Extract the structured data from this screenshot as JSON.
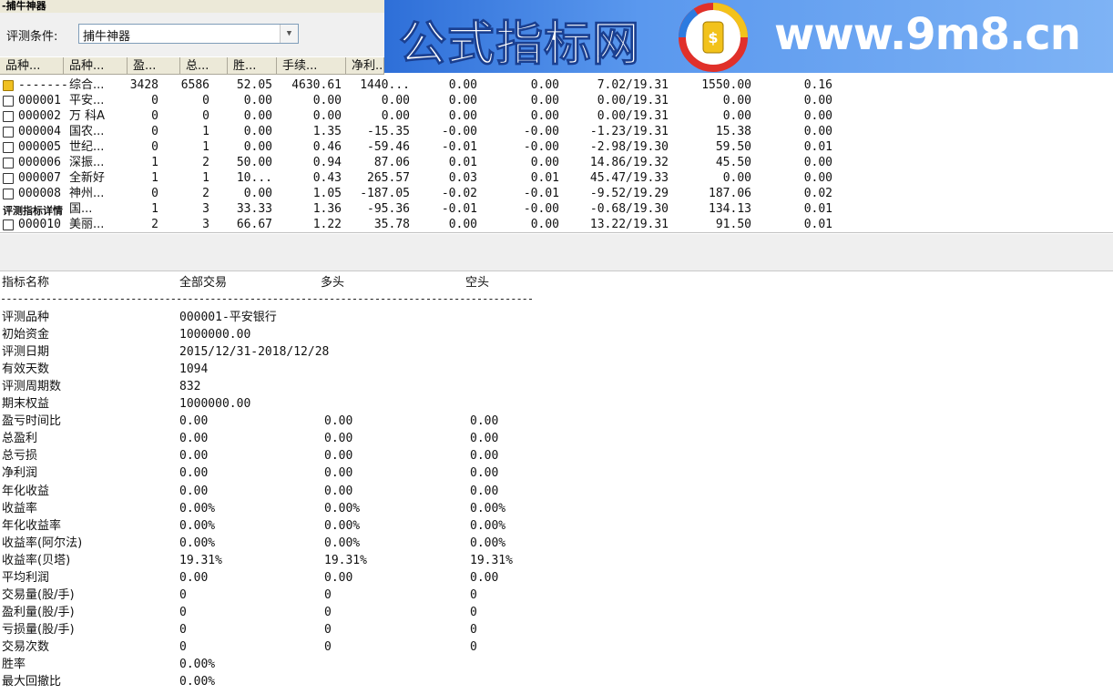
{
  "window": {
    "title": "-捕牛神器"
  },
  "condition": {
    "label": "评测条件:",
    "value": "捕牛神器"
  },
  "banner": {
    "title": "公式指标网",
    "url": "www.9m8.cn",
    "logo_small_text": "www.9m8.cn",
    "colors": {
      "bg": "#3a7ee0",
      "logo_ring": "#e0302a",
      "logo_fill": "#f2c21b"
    }
  },
  "list": {
    "headers": [
      "品种...",
      "品种...",
      "盈...",
      "总...",
      "胜...",
      "手续...",
      "净利..."
    ],
    "details_label": "评测指标详情",
    "rows": [
      {
        "code": "-------",
        "name": "综合...",
        "c1": "3428",
        "c2": "6586",
        "c3": "52.05",
        "c4": "4630.61",
        "c5": "1440...",
        "c6": "0.00",
        "c7": "0.00",
        "c8": "7.02/19.31",
        "c9": "1550.00",
        "c10": "0.16",
        "summary": true
      },
      {
        "code": "000001",
        "name": "平安...",
        "c1": "0",
        "c2": "0",
        "c3": "0.00",
        "c4": "0.00",
        "c5": "0.00",
        "c6": "0.00",
        "c7": "0.00",
        "c8": "0.00/19.31",
        "c9": "0.00",
        "c10": "0.00"
      },
      {
        "code": "000002",
        "name": "万 科A",
        "c1": "0",
        "c2": "0",
        "c3": "0.00",
        "c4": "0.00",
        "c5": "0.00",
        "c6": "0.00",
        "c7": "0.00",
        "c8": "0.00/19.31",
        "c9": "0.00",
        "c10": "0.00"
      },
      {
        "code": "000004",
        "name": "国农...",
        "c1": "0",
        "c2": "1",
        "c3": "0.00",
        "c4": "1.35",
        "c5": "-15.35",
        "c6": "-0.00",
        "c7": "-0.00",
        "c8": "-1.23/19.31",
        "c9": "15.38",
        "c10": "0.00"
      },
      {
        "code": "000005",
        "name": "世纪...",
        "c1": "0",
        "c2": "1",
        "c3": "0.00",
        "c4": "0.46",
        "c5": "-59.46",
        "c6": "-0.01",
        "c7": "-0.00",
        "c8": "-2.98/19.30",
        "c9": "59.50",
        "c10": "0.01"
      },
      {
        "code": "000006",
        "name": "深振...",
        "c1": "1",
        "c2": "2",
        "c3": "50.00",
        "c4": "0.94",
        "c5": "87.06",
        "c6": "0.01",
        "c7": "0.00",
        "c8": "14.86/19.32",
        "c9": "45.50",
        "c10": "0.00"
      },
      {
        "code": "000007",
        "name": "全新好",
        "c1": "1",
        "c2": "1",
        "c3": "10...",
        "c4": "0.43",
        "c5": "265.57",
        "c6": "0.03",
        "c7": "0.01",
        "c8": "45.47/19.33",
        "c9": "0.00",
        "c10": "0.00"
      },
      {
        "code": "000008",
        "name": "神州...",
        "c1": "0",
        "c2": "2",
        "c3": "0.00",
        "c4": "1.05",
        "c5": "-187.05",
        "c6": "-0.02",
        "c7": "-0.01",
        "c8": "-9.52/19.29",
        "c9": "187.06",
        "c10": "0.02"
      },
      {
        "code": "000009",
        "name": "国...",
        "c1": "1",
        "c2": "3",
        "c3": "33.33",
        "c4": "1.36",
        "c5": "-95.36",
        "c6": "-0.01",
        "c7": "-0.00",
        "c8": "-0.68/19.30",
        "c9": "134.13",
        "c10": "0.01"
      },
      {
        "code": "000010",
        "name": "美丽...",
        "c1": "2",
        "c2": "3",
        "c3": "66.67",
        "c4": "1.22",
        "c5": "35.78",
        "c6": "0.00",
        "c7": "0.00",
        "c8": "13.22/19.31",
        "c9": "91.50",
        "c10": "0.01"
      }
    ]
  },
  "report": {
    "headers": {
      "name": "指标名称",
      "all": "全部交易",
      "long": "多头",
      "short": "空头"
    },
    "divider": "------------------------------------------------------------------------------------------------",
    "rows": [
      {
        "name": "评测品种",
        "all": "000001-平安银行",
        "long": "",
        "short": ""
      },
      {
        "name": "初始资金",
        "all": "1000000.00",
        "long": "",
        "short": ""
      },
      {
        "name": "评测日期",
        "all": "2015/12/31-2018/12/28",
        "long": "",
        "short": ""
      },
      {
        "name": "有效天数",
        "all": "1094",
        "long": "",
        "short": ""
      },
      {
        "name": "评测周期数",
        "all": "832",
        "long": "",
        "short": ""
      },
      {
        "name": "期末权益",
        "all": "1000000.00",
        "long": "",
        "short": ""
      },
      {
        "name": "盈亏时间比",
        "all": "0.00",
        "long": "0.00",
        "short": "0.00"
      },
      {
        "name": "总盈利",
        "all": "0.00",
        "long": "0.00",
        "short": "0.00"
      },
      {
        "name": "总亏损",
        "all": "0.00",
        "long": "0.00",
        "short": "0.00"
      },
      {
        "name": "净利润",
        "all": "0.00",
        "long": "0.00",
        "short": "0.00"
      },
      {
        "name": "年化收益",
        "all": "0.00",
        "long": "0.00",
        "short": "0.00"
      },
      {
        "name": "收益率",
        "all": "0.00%",
        "long": "0.00%",
        "short": "0.00%"
      },
      {
        "name": "年化收益率",
        "all": "0.00%",
        "long": "0.00%",
        "short": "0.00%"
      },
      {
        "name": "收益率(阿尔法)",
        "all": "0.00%",
        "long": "0.00%",
        "short": "0.00%"
      },
      {
        "name": "收益率(贝塔)",
        "all": "19.31%",
        "long": "19.31%",
        "short": "19.31%"
      },
      {
        "name": "平均利润",
        "all": "0.00",
        "long": "0.00",
        "short": "0.00"
      },
      {
        "name": "交易量(股/手)",
        "all": "0",
        "long": "0",
        "short": "0"
      },
      {
        "name": "盈利量(股/手)",
        "all": "0",
        "long": "0",
        "short": "0"
      },
      {
        "name": "亏损量(股/手)",
        "all": "0",
        "long": "0",
        "short": "0"
      },
      {
        "name": "交易次数",
        "all": "0",
        "long": "0",
        "short": "0"
      },
      {
        "name": "胜率",
        "all": "0.00%",
        "long": "",
        "short": ""
      },
      {
        "name": "最大回撤比",
        "all": "0.00%",
        "long": "",
        "short": ""
      }
    ]
  }
}
